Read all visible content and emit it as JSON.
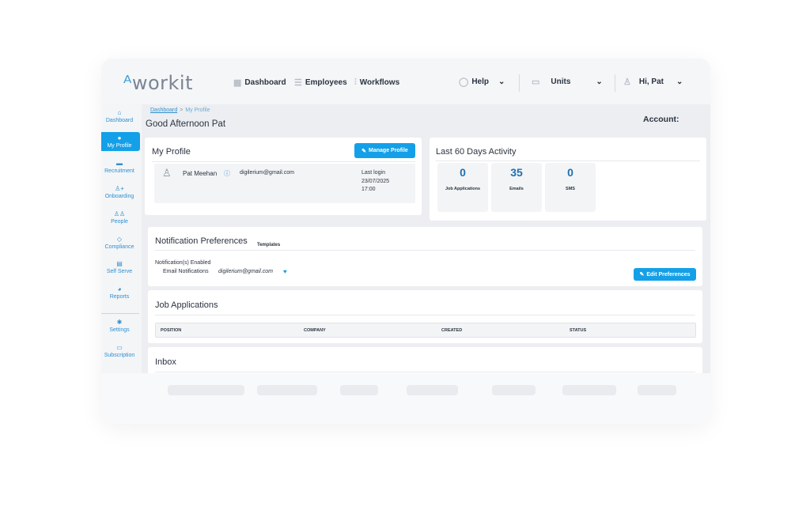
{
  "app": {
    "logo_text_a": "ᴬ",
    "logo_text": "workit",
    "brand_color": "#14a0e8"
  },
  "topnav": {
    "dashboard": "Dashboard",
    "employees": "Employees",
    "workflows": "Workflows",
    "help": "Help",
    "units": "Units",
    "user": "Hi, Pat"
  },
  "sidebar": {
    "items": [
      {
        "label": "Dashboard",
        "icon": "home-icon"
      },
      {
        "label": "My Profile",
        "icon": "user-circle-icon"
      },
      {
        "label": "Recruitment",
        "icon": "briefcase-icon"
      },
      {
        "label": "Onboarding",
        "icon": "user-plus-icon"
      },
      {
        "label": "People",
        "icon": "people-icon"
      },
      {
        "label": "Compliance",
        "icon": "shield-icon"
      },
      {
        "label": "Self Serve",
        "icon": "document-icon"
      },
      {
        "label": "Reports",
        "icon": "pie-chart-icon"
      },
      {
        "label": "Settings",
        "icon": "gear-icon"
      },
      {
        "label": "Subscription",
        "icon": "card-icon"
      }
    ]
  },
  "breadcrumb": {
    "root": "Dashboard",
    "sep": ">",
    "current": "My Profile"
  },
  "greeting": "Good Afternoon Pat",
  "account_label": "Account:",
  "profile": {
    "title": "My Profile",
    "manage_button": "Manage Profile",
    "name": "Pat Meehan",
    "email": "digilerium@gmail.com",
    "last_login_label": "Last login",
    "last_login_date": "23/07/2025",
    "last_login_time": "17:00"
  },
  "activity": {
    "title": "Last 60 Days Activity",
    "stats": [
      {
        "value": "0",
        "label": "Job Applications"
      },
      {
        "value": "35",
        "label": "Emails"
      },
      {
        "value": "0",
        "label": "SMS"
      }
    ]
  },
  "notifications": {
    "title": "Notification Preferences",
    "templates_tab": "Templates",
    "enabled_label": "Notification(s) Enabled",
    "email_label": "Email Notifications",
    "email_value": "digilerium@gmail.com",
    "edit_button": "Edit Preferences"
  },
  "job_applications": {
    "title": "Job Applications",
    "columns": [
      "POSITION",
      "COMPANY",
      "CREATED",
      "STATUS"
    ]
  },
  "inbox": {
    "title": "Inbox"
  }
}
